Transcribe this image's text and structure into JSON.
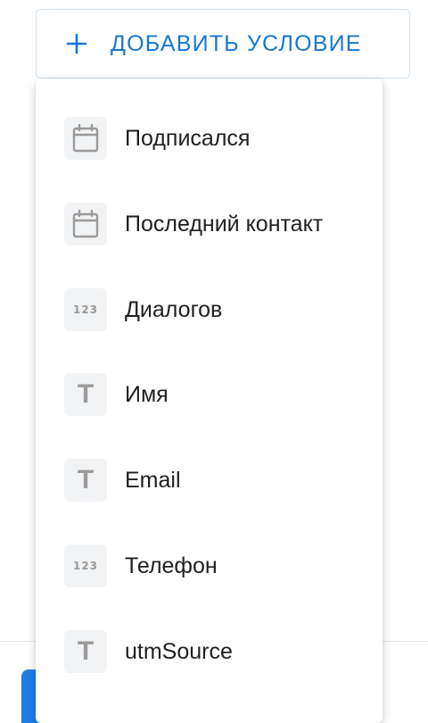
{
  "add_button": {
    "label": "ДОБАВИТЬ УСЛОВИЕ",
    "icon": "plus-icon",
    "color": "#1877d4"
  },
  "menu": {
    "items": [
      {
        "label": "Подписался",
        "icon": "calendar-icon"
      },
      {
        "label": "Последний контакт",
        "icon": "calendar-icon"
      },
      {
        "label": "Диалогов",
        "icon": "number-icon",
        "glyph": "123"
      },
      {
        "label": "Имя",
        "icon": "text-icon",
        "glyph": "T"
      },
      {
        "label": "Email",
        "icon": "text-icon",
        "glyph": "T"
      },
      {
        "label": "Телефон",
        "icon": "number-icon",
        "glyph": "123"
      },
      {
        "label": "utmSource",
        "icon": "text-icon",
        "glyph": "T"
      }
    ]
  },
  "colors": {
    "accent": "#1877d4",
    "primary_button": "#1e7fe6",
    "icon_bg": "#f2f3f5",
    "icon_fg": "#9a9a9a"
  }
}
